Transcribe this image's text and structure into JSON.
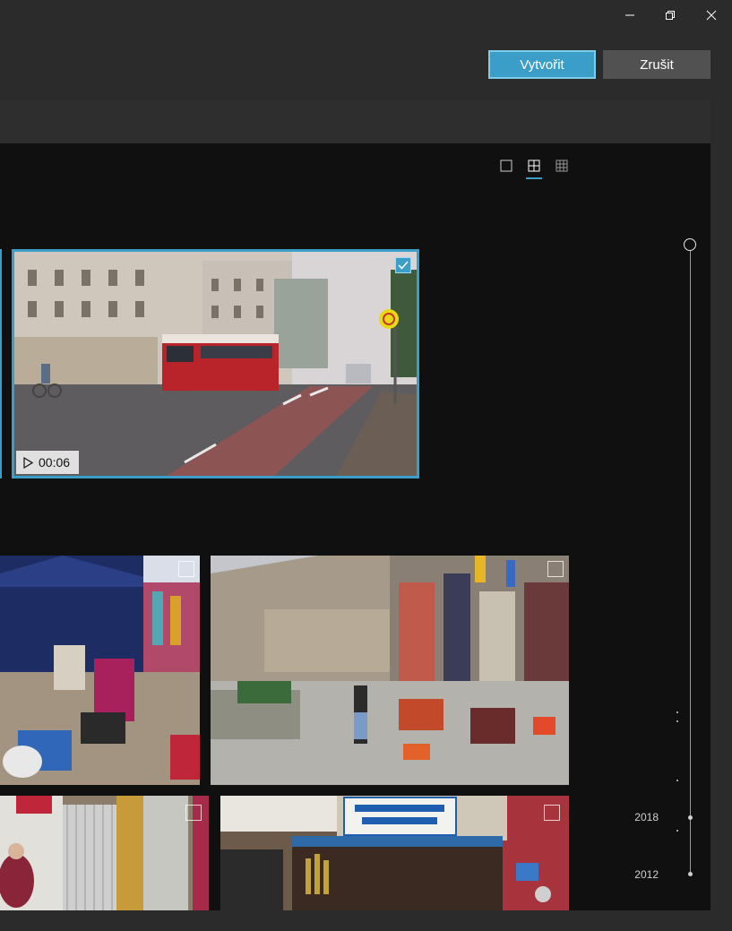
{
  "window": {
    "controls": [
      {
        "name": "minimize-icon"
      },
      {
        "name": "restore-icon"
      },
      {
        "name": "close-icon"
      }
    ]
  },
  "actions": {
    "create_label": "Vytvořit",
    "cancel_label": "Zrušit"
  },
  "view_options": [
    {
      "name": "single-view-icon",
      "active": false
    },
    {
      "name": "medium-grid-icon",
      "active": true
    },
    {
      "name": "small-grid-icon",
      "active": false
    }
  ],
  "selected_item": {
    "type": "video",
    "duration": "00:06",
    "checked": true,
    "subject": "tram street scene"
  },
  "grid_items": [
    {
      "subject": "market stall",
      "checked": false
    },
    {
      "subject": "street market",
      "checked": false
    },
    {
      "subject": "shop front",
      "checked": false
    },
    {
      "subject": "hardware store",
      "checked": false
    }
  ],
  "timeline": {
    "years": [
      "2018",
      "2012"
    ]
  },
  "colors": {
    "accent": "#3b9ec9",
    "background": "#2b2b2b",
    "panel": "#111010"
  }
}
